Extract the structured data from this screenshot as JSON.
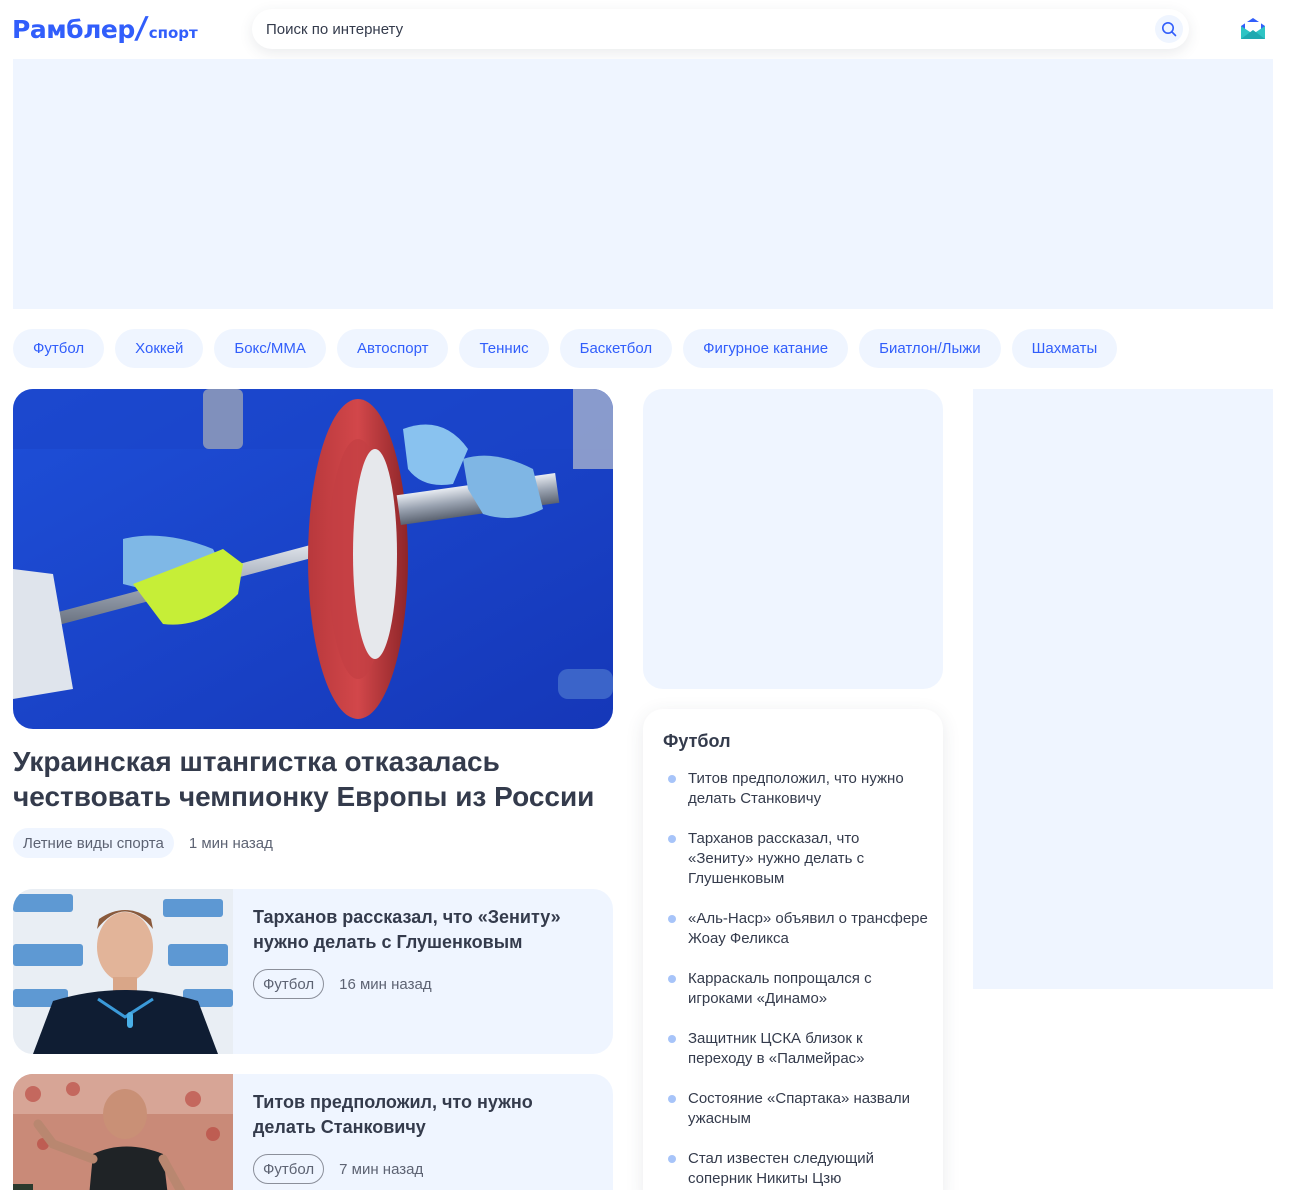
{
  "header": {
    "logo_main": "Рамблер",
    "logo_sub": "спорт",
    "search_placeholder": "Поиск по интернету",
    "search_icon": "search-icon",
    "mail_icon": "mail-icon"
  },
  "topics": [
    "Футбол",
    "Хоккей",
    "Бокс/ММА",
    "Автоспорт",
    "Теннис",
    "Баскетбол",
    "Фигурное катание",
    "Биатлон/Лыжи",
    "Шахматы"
  ],
  "main_article": {
    "title": "Украинская штангистка отказалась чествовать чемпионку Европы из России",
    "tag": "Летние виды спорта",
    "time": "1 мин назад"
  },
  "cards": [
    {
      "title": "Тарханов рассказал, что «Зениту» нужно делать с Глушенковым",
      "tag": "Футбол",
      "time": "16 мин назад"
    },
    {
      "title": "Титов предположил, что нужно делать Станковичу",
      "tag": "Футбол",
      "time": "7 мин назад"
    }
  ],
  "football_widget": {
    "title": "Футбол",
    "items": [
      "Титов предположил, что нужно делать Станковичу",
      "Тарханов рассказал, что «Зениту» нужно делать с Глушенковым",
      "«Аль-Наср» объявил о трансфере Жоау Феликса",
      "Карраскаль попрощался с игроками «Динамо»",
      "Защитник ЦСКА близок к переходу в «Палмейрас»",
      "Состояние «Спартака» назвали ужасным",
      "Стал известен следующий соперник Никиты Цзю"
    ]
  },
  "colors": {
    "accent": "#315efb",
    "bg_light": "#eff5ff",
    "text": "#343b4c"
  }
}
